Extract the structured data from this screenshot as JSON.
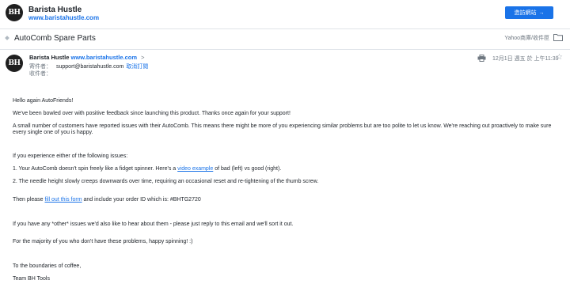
{
  "header": {
    "logo_text": "BH",
    "brand_name": "Barista Hustle",
    "brand_url": "www.baristahustle.com",
    "visit_button": "造訪網站",
    "visit_arrow": "→"
  },
  "subject_bar": {
    "subject": "AutoComb Spare Parts",
    "folder_path": "Yahoo商庫/收件匣"
  },
  "message": {
    "avatar_text": "BH",
    "from_name": "Barista Hustle",
    "from_url": "www.baristahustle.com",
    "from_chevron": ">",
    "sender_label": "寄件者：",
    "sender_value": "support@baristahustle.com",
    "unsubscribe": "取消訂閱",
    "recipient_label": "收件者：",
    "date": "12月1日 週五 於 上午11:39"
  },
  "body": {
    "greeting": "Hello again AutoFriends!",
    "p1": "We've been bowled over with positive feedback since launching this product. Thanks once again for your support!",
    "p2_line1": "A small number of customers have reported issues with their AutoComb. This means there might be more of you experiencing similar problems but are too polite to let us know. We're reaching out proactively to make sure",
    "p2_line2": "every single one of you is happy.",
    "p3": "If you experience either of the following issues:",
    "item1_before": "1. Your AutoComb doesn't spin freely like a fidget spinner. Here's a",
    "item1_link": "video example",
    "item1_after": "of bad (left) vs good (right).",
    "item2": "2. The needle height slowly creeps downwards over time, requiring an occasional reset and re-tightening of the thumb screw.",
    "fill_before": "Then please",
    "fill_link": "fill out this form",
    "fill_after": "and include your order ID which is: #BHTG2720",
    "other": "If you have any *other* issues we'd also like to hear about them - please just reply to this email and we'll sort it out.",
    "majority": "For the majority of you who don't have these problems, happy spinning! :)",
    "signoff": "To the boundaries of coffee,",
    "team": "Team BH Tools"
  }
}
